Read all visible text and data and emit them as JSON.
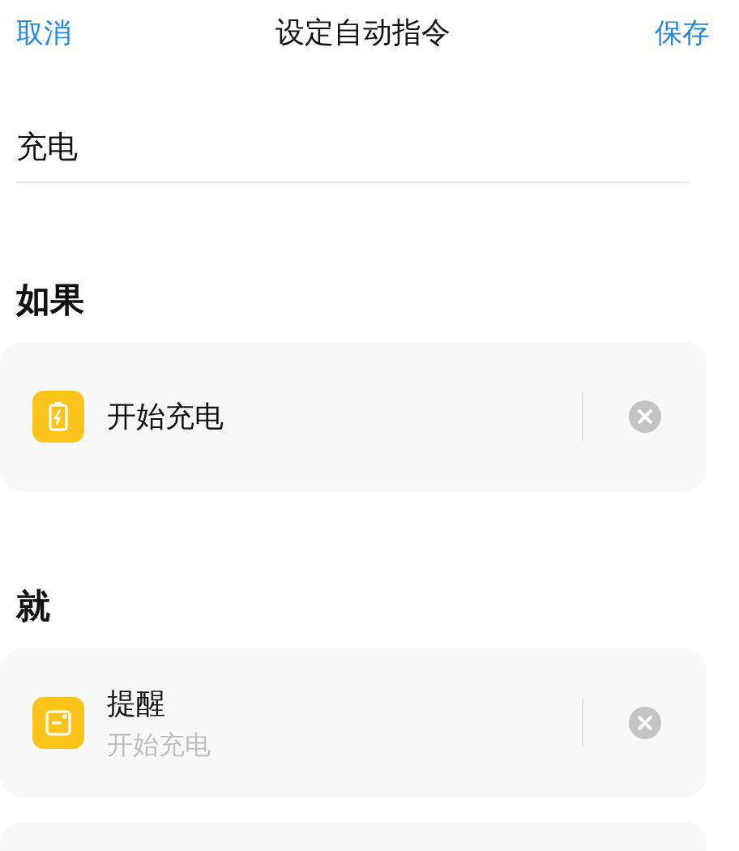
{
  "header": {
    "cancel": "取消",
    "title": "设定自动指令",
    "save": "保存"
  },
  "name_field": {
    "value": "充电"
  },
  "sections": [
    {
      "heading": "如果",
      "items": [
        {
          "kind": "battery",
          "title": "开始充电"
        }
      ]
    },
    {
      "heading": "就",
      "items": [
        {
          "kind": "reminder",
          "title": "提醒",
          "subtitle": "开始充电"
        }
      ]
    }
  ]
}
